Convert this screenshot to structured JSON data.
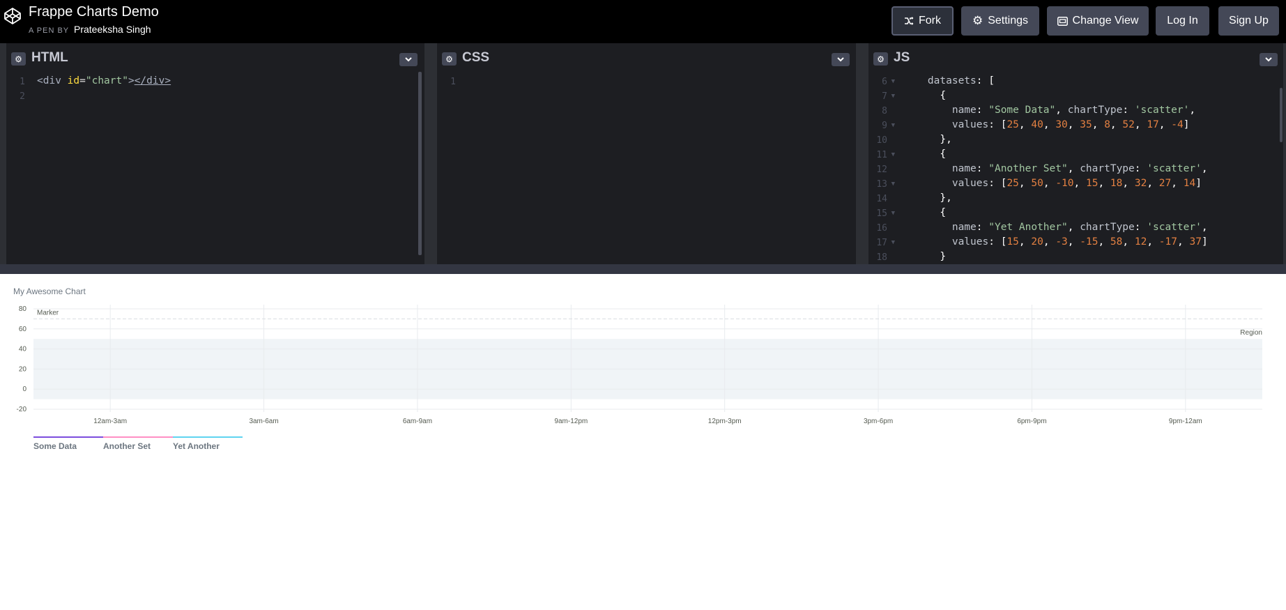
{
  "header": {
    "pen_title": "Frappe Charts Demo",
    "pen_by": "A PEN BY",
    "author": "Prateeksha Singh",
    "buttons": {
      "fork": "Fork",
      "settings": "Settings",
      "change_view": "Change View",
      "log_in": "Log In",
      "sign_up": "Sign Up"
    }
  },
  "editors": {
    "html": {
      "title": "HTML",
      "line_numbers": [
        "1",
        "2"
      ],
      "code": "<div id=\"chart\"></div>"
    },
    "css": {
      "title": "CSS",
      "line_numbers": [
        "1"
      ]
    },
    "js": {
      "title": "JS",
      "line_numbers": [
        "6",
        "7",
        "8",
        "9",
        "10",
        "11",
        "12",
        "13",
        "14",
        "15",
        "16",
        "17",
        "18"
      ],
      "lines": [
        "    datasets: [",
        "      {",
        "        name: \"Some Data\", chartType: 'scatter',",
        "        values: [25, 40, 30, 35, 8, 52, 17, -4]",
        "      },",
        "      {",
        "        name: \"Another Set\", chartType: 'scatter',",
        "        values: [25, 50, -10, 15, 18, 32, 27, 14]",
        "      },",
        "      {",
        "        name: \"Yet Another\", chartType: 'scatter',",
        "        values: [15, 20, -3, -15, 58, 12, -17, 37]",
        "      }"
      ]
    }
  },
  "chart_data": {
    "type": "scatter",
    "title": "My Awesome Chart",
    "categories": [
      "12am-3am",
      "3am-6am",
      "6am-9am",
      "9am-12pm",
      "12pm-3pm",
      "3pm-6pm",
      "6pm-9pm",
      "9pm-12am"
    ],
    "yticks": [
      -20,
      0,
      20,
      40,
      60,
      80
    ],
    "ylim": [
      -20,
      80
    ],
    "marker": {
      "label": "Marker",
      "value": 70
    },
    "region": {
      "label": "Region",
      "start": -10,
      "end": 50
    },
    "series": [
      {
        "name": "Some Data",
        "color": "#7c4ddd"
      },
      {
        "name": "Another Set",
        "color": "#ff8fc4"
      },
      {
        "name": "Yet Another",
        "color": "#5fd4f0"
      }
    ],
    "legend": "bottom-left",
    "grid": true
  }
}
